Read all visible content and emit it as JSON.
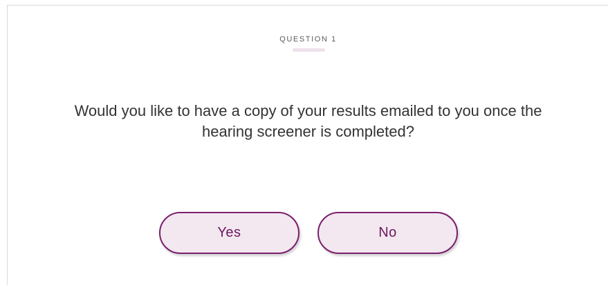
{
  "question": {
    "eyebrow": "QUESTION 1",
    "text": "Would you like to have a copy of your results emailed to you once the hearing screener is completed?"
  },
  "answers": {
    "yes_label": "Yes",
    "no_label": "No"
  },
  "colors": {
    "accent": "#7b1e6b",
    "button_fill": "#f3e7f0",
    "eyebrow_bar": "#efe1ec",
    "text": "#333333"
  }
}
